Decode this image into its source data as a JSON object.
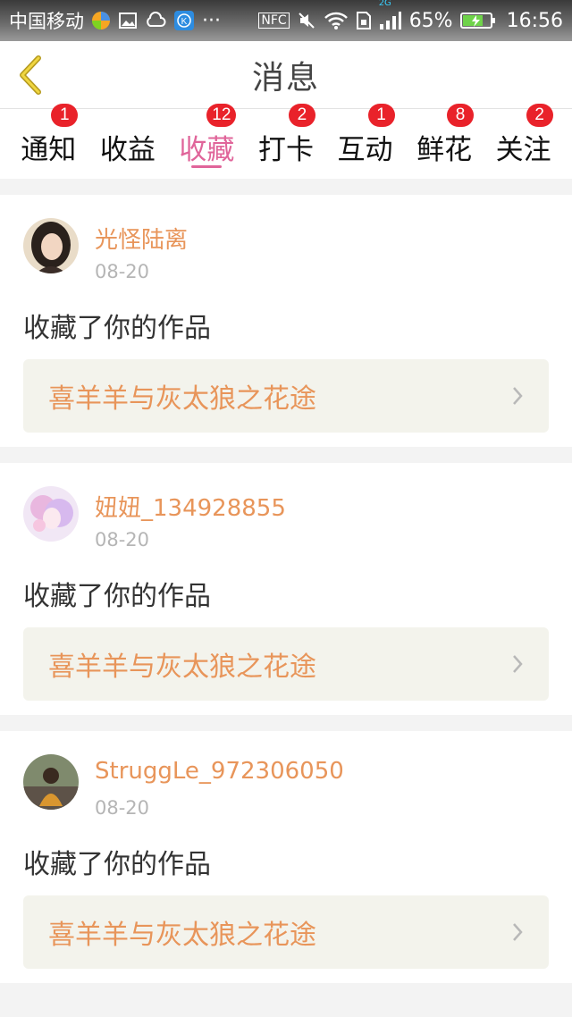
{
  "statusbar": {
    "carrier": "中国移动",
    "ellipsis": "···",
    "nfc": "NFC",
    "network": "2G",
    "battery": "65%",
    "time": "16:56"
  },
  "header": {
    "title": "消息"
  },
  "tabs": [
    {
      "label": "通知",
      "badge": "1",
      "active": false
    },
    {
      "label": "收益",
      "badge": "",
      "active": false
    },
    {
      "label": "收藏",
      "badge": "12",
      "active": true
    },
    {
      "label": "打卡",
      "badge": "2",
      "active": false
    },
    {
      "label": "互动",
      "badge": "1",
      "active": false
    },
    {
      "label": "鲜花",
      "badge": "8",
      "active": false
    },
    {
      "label": "关注",
      "badge": "2",
      "active": false
    }
  ],
  "messages": [
    {
      "user": "光怪陆离",
      "date": "08-20",
      "action": "收藏了你的作品",
      "work": "喜羊羊与灰太狼之花途"
    },
    {
      "user": "妞妞_134928855",
      "date": "08-20",
      "action": "收藏了你的作品",
      "work": "喜羊羊与灰太狼之花途"
    },
    {
      "user": "StruggLe_972306050",
      "date": "08-20",
      "action": "收藏了你的作品",
      "work": "喜羊羊与灰太狼之花途"
    }
  ],
  "colors": {
    "accent": "#e0659a",
    "orange": "#e8955a",
    "badge": "#e9222a"
  }
}
